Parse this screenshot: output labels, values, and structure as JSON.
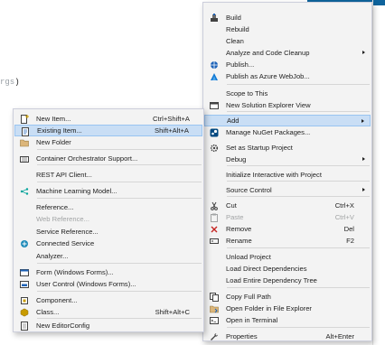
{
  "background": {
    "code_snippet_muted": "rgs",
    "code_snippet_paren": ")"
  },
  "context_menu": {
    "items": [
      {
        "label": "Build",
        "icon": "build-icon",
        "shortcut": "",
        "disabled": false,
        "submenu": false
      },
      {
        "label": "Rebuild",
        "icon": "",
        "shortcut": "",
        "disabled": false,
        "submenu": false
      },
      {
        "label": "Clean",
        "icon": "",
        "shortcut": "",
        "disabled": false,
        "submenu": false
      },
      {
        "label": "Analyze and Code Cleanup",
        "icon": "",
        "shortcut": "",
        "disabled": false,
        "submenu": true
      },
      {
        "label": "Publish...",
        "icon": "globe-icon",
        "shortcut": "",
        "disabled": false,
        "submenu": false
      },
      {
        "label": "Publish as Azure WebJob...",
        "icon": "azure-icon",
        "shortcut": "",
        "disabled": false,
        "submenu": false
      },
      {
        "label": "Scope to This",
        "icon": "",
        "shortcut": "",
        "disabled": false,
        "submenu": false
      },
      {
        "label": "New Solution Explorer View",
        "icon": "window-icon",
        "shortcut": "",
        "disabled": false,
        "submenu": false
      },
      {
        "label": "Add",
        "icon": "",
        "shortcut": "",
        "disabled": false,
        "submenu": true,
        "highlighted": true
      },
      {
        "label": "Manage NuGet Packages...",
        "icon": "nuget-icon",
        "shortcut": "",
        "disabled": false,
        "submenu": false
      },
      {
        "label": "Set as Startup Project",
        "icon": "gear-icon",
        "shortcut": "",
        "disabled": false,
        "submenu": false
      },
      {
        "label": "Debug",
        "icon": "",
        "shortcut": "",
        "disabled": false,
        "submenu": true
      },
      {
        "label": "Initialize Interactive with Project",
        "icon": "",
        "shortcut": "",
        "disabled": false,
        "submenu": false
      },
      {
        "label": "Source Control",
        "icon": "",
        "shortcut": "",
        "disabled": false,
        "submenu": true
      },
      {
        "label": "Cut",
        "icon": "scissors-icon",
        "shortcut": "Ctrl+X",
        "disabled": false,
        "submenu": false
      },
      {
        "label": "Paste",
        "icon": "paste-icon",
        "shortcut": "Ctrl+V",
        "disabled": true,
        "submenu": false
      },
      {
        "label": "Remove",
        "icon": "remove-icon",
        "shortcut": "Del",
        "disabled": false,
        "submenu": false
      },
      {
        "label": "Rename",
        "icon": "rename-icon",
        "shortcut": "F2",
        "disabled": false,
        "submenu": false
      },
      {
        "label": "Unload Project",
        "icon": "",
        "shortcut": "",
        "disabled": false,
        "submenu": false
      },
      {
        "label": "Load Direct Dependencies",
        "icon": "",
        "shortcut": "",
        "disabled": false,
        "submenu": false
      },
      {
        "label": "Load Entire Dependency Tree",
        "icon": "",
        "shortcut": "",
        "disabled": false,
        "submenu": false
      },
      {
        "label": "Copy Full Path",
        "icon": "copy-icon",
        "shortcut": "",
        "disabled": false,
        "submenu": false
      },
      {
        "label": "Open Folder in File Explorer",
        "icon": "open-folder-icon",
        "shortcut": "",
        "disabled": false,
        "submenu": false
      },
      {
        "label": "Open in Terminal",
        "icon": "terminal-icon",
        "shortcut": "",
        "disabled": false,
        "submenu": false
      },
      {
        "label": "Properties",
        "icon": "wrench-icon",
        "shortcut": "Alt+Enter",
        "disabled": false,
        "submenu": false
      }
    ]
  },
  "add_submenu": {
    "items": [
      {
        "label": "New Item...",
        "icon": "new-item-icon",
        "shortcut": "Ctrl+Shift+A",
        "disabled": false
      },
      {
        "label": "Existing Item...",
        "icon": "existing-item-icon",
        "shortcut": "Shift+Alt+A",
        "disabled": false,
        "highlighted": true
      },
      {
        "label": "New Folder",
        "icon": "folder-icon",
        "shortcut": "",
        "disabled": false
      },
      {
        "label": "Container Orchestrator Support...",
        "icon": "container-icon",
        "shortcut": "",
        "disabled": false
      },
      {
        "label": "REST API Client...",
        "icon": "",
        "shortcut": "",
        "disabled": false
      },
      {
        "label": "Machine Learning Model...",
        "icon": "ml-model-icon",
        "shortcut": "",
        "disabled": false
      },
      {
        "label": "Reference...",
        "icon": "",
        "shortcut": "",
        "disabled": false
      },
      {
        "label": "Web Reference...",
        "icon": "",
        "shortcut": "",
        "disabled": true
      },
      {
        "label": "Service Reference...",
        "icon": "",
        "shortcut": "",
        "disabled": false
      },
      {
        "label": "Connected Service",
        "icon": "connected-service-icon",
        "shortcut": "",
        "disabled": false
      },
      {
        "label": "Analyzer...",
        "icon": "",
        "shortcut": "",
        "disabled": false
      },
      {
        "label": "Form (Windows Forms)...",
        "icon": "form-icon",
        "shortcut": "",
        "disabled": false
      },
      {
        "label": "User Control (Windows Forms)...",
        "icon": "user-control-icon",
        "shortcut": "",
        "disabled": false
      },
      {
        "label": "Component...",
        "icon": "component-icon",
        "shortcut": "",
        "disabled": false
      },
      {
        "label": "Class...",
        "icon": "class-icon",
        "shortcut": "Shift+Alt+C",
        "disabled": false
      },
      {
        "label": "New EditorConfig",
        "icon": "editorconfig-icon",
        "shortcut": "",
        "disabled": false
      }
    ]
  },
  "colors": {
    "menu_bg": "#f3f3f3",
    "highlight_bg": "#c9def5",
    "highlight_border": "#99c4f1",
    "accent_blue": "#1e63b8",
    "disabled_text": "#a2a4a5"
  }
}
